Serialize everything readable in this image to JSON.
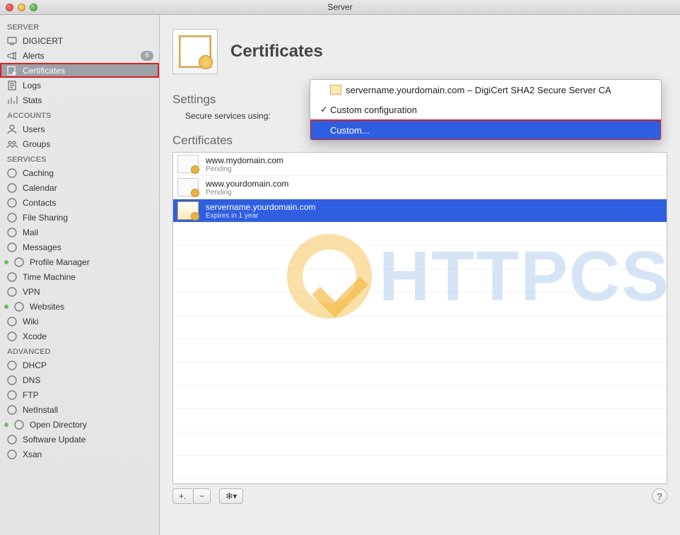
{
  "window": {
    "title": "Server"
  },
  "sidebar": {
    "sections": [
      {
        "header": "SERVER",
        "items": [
          {
            "icon": "monitor-icon",
            "label": "DIGICERT"
          },
          {
            "icon": "megaphone-icon",
            "label": "Alerts",
            "badge": "6"
          },
          {
            "icon": "certificate-icon",
            "label": "Certificates",
            "highlighted": true
          },
          {
            "icon": "log-icon",
            "label": "Logs"
          },
          {
            "icon": "stats-icon",
            "label": "Stats"
          }
        ]
      },
      {
        "header": "ACCOUNTS",
        "items": [
          {
            "icon": "user-icon",
            "label": "Users"
          },
          {
            "icon": "group-icon",
            "label": "Groups"
          }
        ]
      },
      {
        "header": "SERVICES",
        "items": [
          {
            "icon": "caching-icon",
            "label": "Caching"
          },
          {
            "icon": "calendar-icon",
            "label": "Calendar"
          },
          {
            "icon": "contacts-icon",
            "label": "Contacts"
          },
          {
            "icon": "filesharing-icon",
            "label": "File Sharing"
          },
          {
            "icon": "mail-icon",
            "label": "Mail"
          },
          {
            "icon": "messages-icon",
            "label": "Messages"
          },
          {
            "icon": "profile-icon",
            "label": "Profile Manager",
            "dot": true
          },
          {
            "icon": "timemachine-icon",
            "label": "Time Machine"
          },
          {
            "icon": "vpn-icon",
            "label": "VPN"
          },
          {
            "icon": "websites-icon",
            "label": "Websites",
            "dot": true
          },
          {
            "icon": "wiki-icon",
            "label": "Wiki"
          },
          {
            "icon": "xcode-icon",
            "label": "Xcode"
          }
        ]
      },
      {
        "header": "ADVANCED",
        "items": [
          {
            "icon": "dhcp-icon",
            "label": "DHCP"
          },
          {
            "icon": "dns-icon",
            "label": "DNS"
          },
          {
            "icon": "ftp-icon",
            "label": "FTP"
          },
          {
            "icon": "netinstall-icon",
            "label": "NetInstall"
          },
          {
            "icon": "opendirectory-icon",
            "label": "Open Directory",
            "dot": true
          },
          {
            "icon": "softwareupdate-icon",
            "label": "Software Update"
          },
          {
            "icon": "xsan-icon",
            "label": "Xsan"
          }
        ]
      }
    ]
  },
  "main": {
    "title": "Certificates",
    "settings_label": "Settings",
    "secure_label": "Secure services using:",
    "certs_label": "Certificates",
    "certs": [
      {
        "name": "www.mydomain.com",
        "status": "Pending",
        "selected": false,
        "gold": false
      },
      {
        "name": "www.yourdomain.com",
        "status": "Pending",
        "selected": false,
        "gold": false
      },
      {
        "name": "servername.yourdomain.com",
        "status": "Expires in 1 year",
        "selected": true,
        "gold": true
      }
    ],
    "footer": {
      "add": "+.",
      "remove": "−",
      "gear": "✻▾",
      "help": "?"
    }
  },
  "dropdown": {
    "option1": "servername.yourdomain.com – DigiCert SHA2 Secure Server CA",
    "option2": "Custom configuration",
    "option3": "Custom...",
    "checkmark": "✓"
  },
  "watermark": "HTTPCS"
}
